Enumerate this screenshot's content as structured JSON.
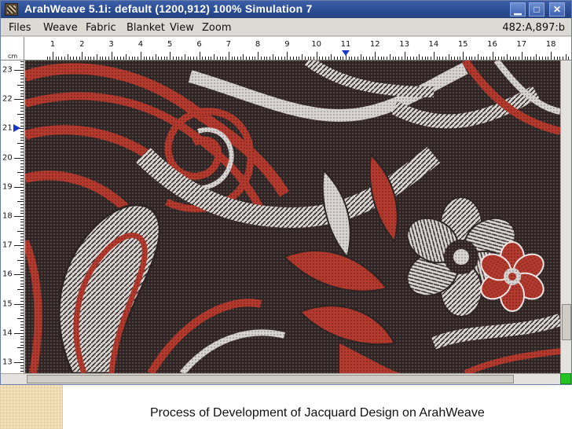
{
  "window": {
    "title": "ArahWeave 5.1i: default (1200,912) 100% Simulation 7",
    "controls": {
      "minimize": "▁",
      "maximize": "□",
      "close": "✕"
    }
  },
  "menu": {
    "items": [
      "Files",
      "Weave",
      "Fabric",
      "Blanket",
      "View",
      "Zoom"
    ],
    "status_readout": "482:A,897:b"
  },
  "ruler": {
    "unit": "cm",
    "top_labels": [
      "1",
      "2",
      "3",
      "4",
      "5",
      "6",
      "7",
      "8",
      "9",
      "10",
      "11",
      "12",
      "13",
      "14",
      "15",
      "16",
      "17",
      "18"
    ],
    "left_labels": [
      "23",
      "22",
      "21",
      "20",
      "19",
      "18",
      "17",
      "16",
      "15",
      "14",
      "13"
    ],
    "top_marker_at": 11,
    "left_marker_at": 21
  },
  "fabric": {
    "description_colors": {
      "dark": "#2e2424",
      "red": "#b23a2e",
      "light": "#d8d4d2",
      "mid": "#6e5a58"
    }
  },
  "slide": {
    "caption": "Process of Development of Jacquard Design on ArahWeave"
  }
}
